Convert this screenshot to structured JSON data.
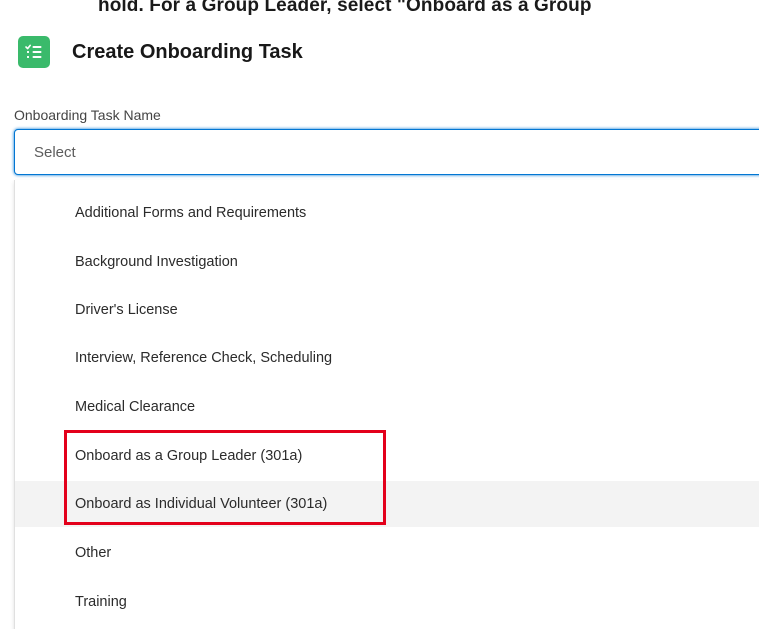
{
  "caption": {
    "text": "hold. For a Group Leader, select \"Onboard as a Group"
  },
  "header": {
    "title": "Create Onboarding Task",
    "icon": "task-list-icon",
    "icon_color": "#3aba6b"
  },
  "field": {
    "label": "Onboarding Task Name",
    "placeholder": "Select",
    "focus_color": "#0176d3"
  },
  "dropdown": {
    "options": [
      "Additional Forms and Requirements",
      "Background Investigation",
      "Driver's License",
      "Interview, Reference Check, Scheduling",
      "Medical Clearance",
      "Onboard as a Group Leader (301a)",
      "Onboard as Individual Volunteer (301a)",
      "Other",
      "Training"
    ],
    "hovered_option": "Onboard as Individual Volunteer (301a)"
  },
  "annotation": {
    "highlight_color": "#e3001b"
  }
}
